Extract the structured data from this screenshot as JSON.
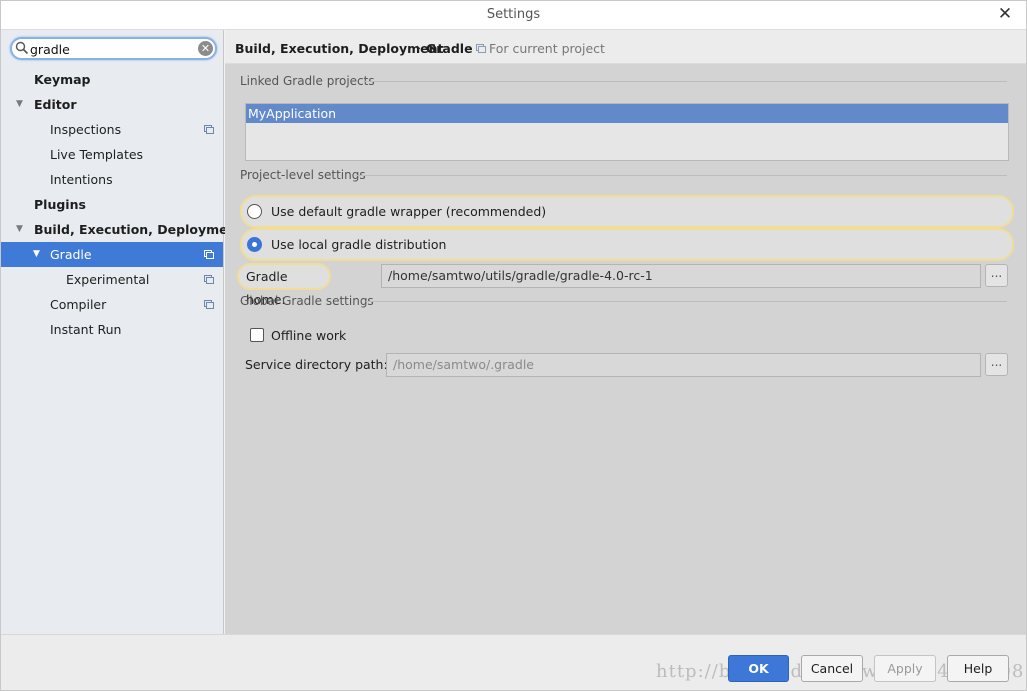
{
  "window": {
    "title": "Settings",
    "close_glyph": "✕"
  },
  "search": {
    "value": "gradle",
    "clear_glyph": "✕"
  },
  "sidebar": {
    "items": [
      {
        "label": "Keymap"
      },
      {
        "label": "Editor"
      },
      {
        "label": "Inspections"
      },
      {
        "label": "Live Templates"
      },
      {
        "label": "Intentions"
      },
      {
        "label": "Plugins"
      },
      {
        "label": "Build, Execution, Deployment"
      },
      {
        "label": "Gradle",
        "selected": true
      },
      {
        "label": "Experimental"
      },
      {
        "label": "Compiler"
      },
      {
        "label": "Instant Run"
      }
    ],
    "selected_color": "#3f7ad6"
  },
  "breadcrumb": {
    "parent": "Build, Execution, Deployment",
    "separator": "›",
    "current": "Gradle",
    "scope": "For current project"
  },
  "linked": {
    "header": "Linked Gradle projects",
    "projects": [
      "MyApplication"
    ]
  },
  "project_level": {
    "header": "Project-level settings",
    "option_default_wrapper": "Use default gradle wrapper (recommended)",
    "option_local_distribution": "Use local gradle distribution",
    "selected_option": "local",
    "gradle_home_label": "Gradle home:",
    "gradle_home_value": "/home/samtwo/utils/gradle/gradle-4.0-rc-1"
  },
  "global": {
    "header": "Global Gradle settings",
    "offline_work_label": "Offline work",
    "offline_work_checked": false,
    "service_dir_label": "Service directory path:",
    "service_dir_placeholder": "/home/samtwo/.gradle"
  },
  "browse_glyph": "...",
  "buttons": {
    "ok": "OK",
    "cancel": "Cancel",
    "apply": "Apply",
    "help": "Help"
  },
  "watermark": "http://blog.csdn.net/weixin_4185308",
  "colors": {
    "accent": "#3f7ad6",
    "focus_highlight": "#f1dd96"
  }
}
